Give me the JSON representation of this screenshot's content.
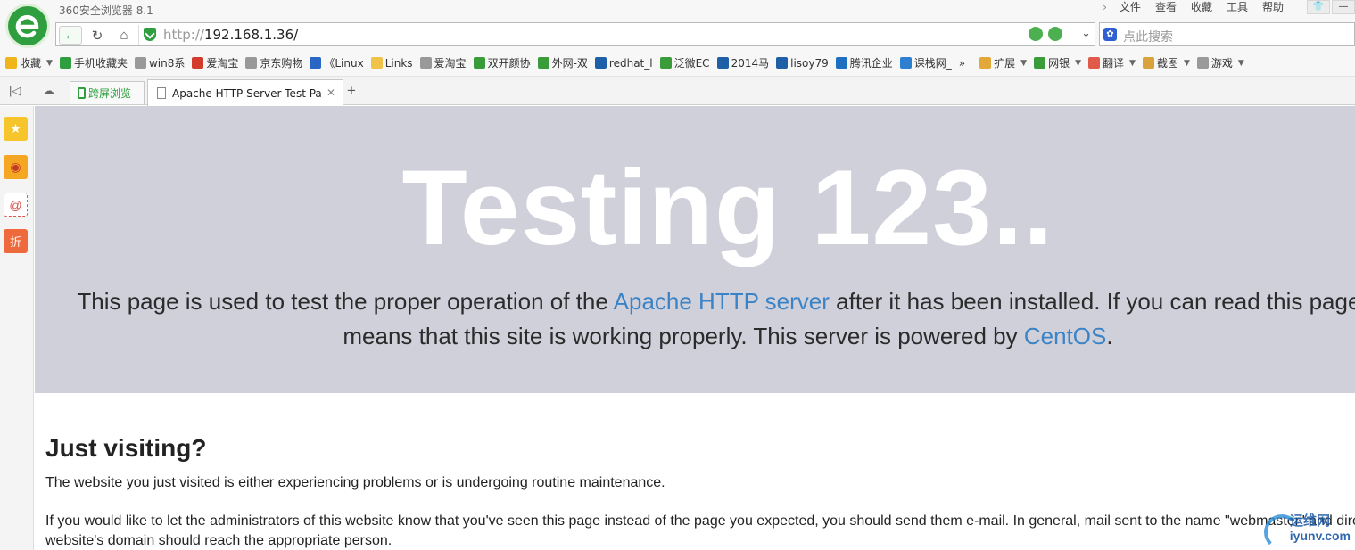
{
  "browser": {
    "app_title": "360安全浏览器 8.1",
    "menu": [
      "文件",
      "查看",
      "收藏",
      "工具",
      "帮助"
    ],
    "url_proto": "http://",
    "url_host": "192.168.1.36/",
    "search_placeholder": "点此搜索",
    "brand_color": "#2f9e3f"
  },
  "bookmarks": [
    {
      "label": "收藏",
      "icon": "star-icon",
      "color": "#f1b51c"
    },
    {
      "label": "手机收藏夹",
      "icon": "phone-icon",
      "color": "#2f9e3f"
    },
    {
      "label": "win8系",
      "icon": "page-icon",
      "color": "#999999"
    },
    {
      "label": "爱淘宝",
      "icon": "taobao-icon",
      "color": "#d33c2c"
    },
    {
      "label": "京东购物",
      "icon": "page-icon",
      "color": "#999999"
    },
    {
      "label": "《Linux",
      "icon": "u-icon",
      "color": "#2a67c5"
    },
    {
      "label": "Links",
      "icon": "folder-icon",
      "color": "#f0c24a"
    },
    {
      "label": "爱淘宝",
      "icon": "page-icon",
      "color": "#999999"
    },
    {
      "label": "双开颜协",
      "icon": "gear-icon",
      "color": "#3a9b3a"
    },
    {
      "label": "外网-双",
      "icon": "gear-icon",
      "color": "#3a9b3a"
    },
    {
      "label": "redhat_l",
      "icon": "link-icon",
      "color": "#1f5fa8"
    },
    {
      "label": "泛微EC",
      "icon": "gear-icon",
      "color": "#3a9b3a"
    },
    {
      "label": "2014马",
      "icon": "link-icon",
      "color": "#1f5fa8"
    },
    {
      "label": "lisoy79",
      "icon": "clock-icon",
      "color": "#1f5fa8"
    },
    {
      "label": "腾讯企业",
      "icon": "mail-icon",
      "color": "#1f6fc0"
    },
    {
      "label": "课栈网_",
      "icon": "ke-icon",
      "color": "#2f7fd0"
    }
  ],
  "toolbar_right": [
    {
      "label": "扩展",
      "icon": "extension-icon"
    },
    {
      "label": "网银",
      "icon": "bank-icon"
    },
    {
      "label": "翻译",
      "icon": "translate-icon"
    },
    {
      "label": "截图",
      "icon": "scissors-icon"
    },
    {
      "label": "游戏",
      "icon": "gamepad-icon"
    }
  ],
  "tabs": {
    "split_label": "跨屏浏览",
    "active_title": "Apache HTTP Server Test Page powered by CentOS"
  },
  "page": {
    "title": "Testing 123..",
    "lead_1": "This page is used to test the proper operation of the ",
    "lead_link_1": "Apache HTTP server",
    "lead_2": " after it has been installed. If you can read this page it means that this site is working properly. This server is powered by ",
    "lead_link_2": "CentOS",
    "lead_3": ".",
    "h2": "Just visiting?",
    "p1": "The website you just visited is either experiencing problems or is undergoing routine maintenance.",
    "p2": "If you would like to let the administrators of this website know that you've seen this page instead of the page you expected, you should send them e-mail. In general, mail sent to the name \"webmaster\" and directed to the website's domain should reach the appropriate person.",
    "jumbo_color": "#d0d0da",
    "link_color": "#3a83c6"
  },
  "watermark": {
    "cn": "运维网",
    "en": "iyunv.com"
  }
}
